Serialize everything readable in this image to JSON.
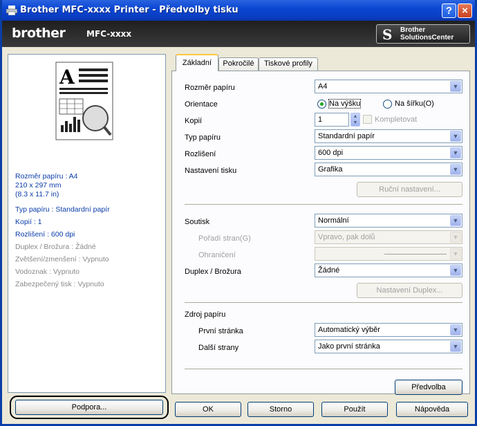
{
  "window": {
    "title": "Brother MFC-xxxx Printer - Předvolby tisku",
    "help_btn": "?",
    "close_btn": "×"
  },
  "brand": {
    "logo": "brother",
    "model": "MFC-xxxx",
    "solutions_line1": "Brother",
    "solutions_line2": "SolutionsCenter"
  },
  "summary": {
    "line1": "Rozměr papíru : A4",
    "line2": "210 x 297 mm",
    "line3": "(8.3 x 11.7 in)",
    "line4": "Typ papíru : Standardní papír",
    "line5": "Kopií : 1",
    "line6": "Rozlišení : 600 dpi",
    "line7": "Duplex / Brožura : Žádné",
    "line8": "Zvětšení/zmenšení : Vypnuto",
    "line9": "Vodoznak : Vypnuto",
    "line10": "Zabezpečený tisk : Vypnuto"
  },
  "support_button": "Podpora...",
  "tabs": {
    "basic": "Základní",
    "advanced": "Pokročilé",
    "profiles": "Tiskové profily"
  },
  "basic": {
    "paper_size_label": "Rozměr papíru",
    "paper_size_value": "A4",
    "orientation_label": "Orientace",
    "portrait": "Na výšku",
    "landscape": "Na šířku(O)",
    "copies_label": "Kopií",
    "copies_value": "1",
    "collate": "Kompletovat",
    "media_label": "Typ papíru",
    "media_value": "Standardní papír",
    "resolution_label": "Rozlišení",
    "resolution_value": "600 dpi",
    "print_settings_label": "Nastavení tisku",
    "print_settings_value": "Grafika",
    "manual_settings_btn": "Ruční nastavení...",
    "multiple_page_label": "Soutisk",
    "multiple_page_value": "Normální",
    "page_order_label": "Pořadí stran(G)",
    "page_order_value": "Vpravo, pak dolů",
    "border_label": "Ohraničení",
    "duplex_label": "Duplex / Brožura",
    "duplex_value": "Žádné",
    "duplex_settings_btn": "Nastavení Duplex...",
    "paper_source_label": "Zdroj papíru",
    "first_page_label": "První stránka",
    "first_page_value": "Automatický výběr",
    "other_pages_label": "Další strany",
    "other_pages_value": "Jako první stránka",
    "default_btn": "Předvolba"
  },
  "footer": {
    "ok": "OK",
    "cancel": "Storno",
    "apply": "Použít",
    "help": "Nápověda"
  },
  "colors": {
    "titlebar": "#0b47d4",
    "summary_text": "#0a3ca8",
    "summary_disabled": "#8a8a8a"
  },
  "icons": [
    "printer-icon",
    "help-icon",
    "close-icon",
    "brother-s-icon",
    "chevron-down-icon",
    "spin-arrows-icon",
    "magnifier-icon"
  ]
}
